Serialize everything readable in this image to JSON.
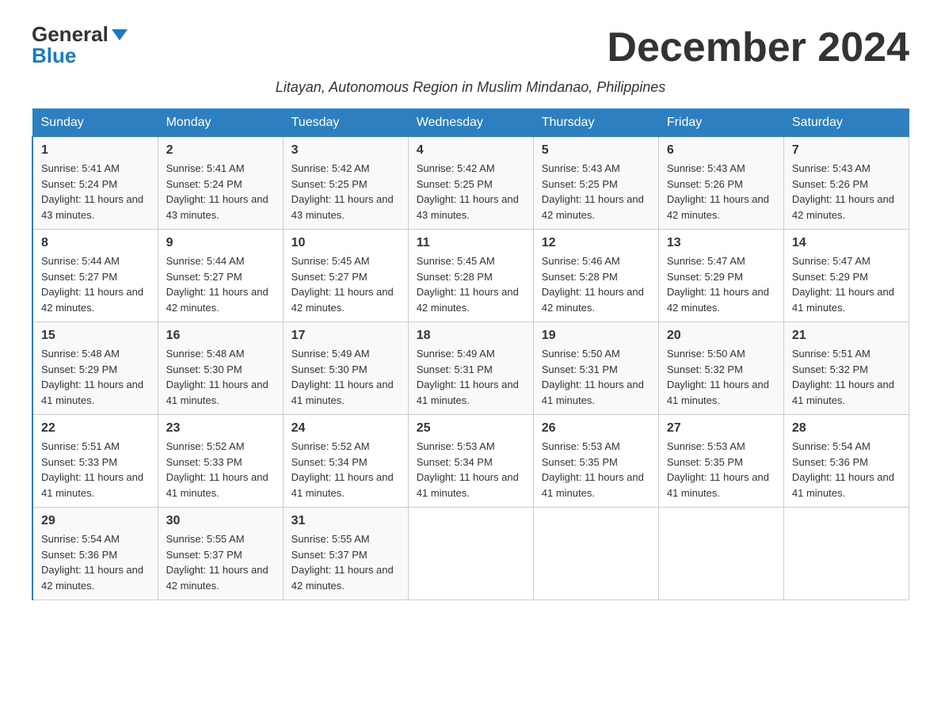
{
  "logo": {
    "general": "General",
    "blue": "Blue"
  },
  "title": "December 2024",
  "subtitle": "Litayan, Autonomous Region in Muslim Mindanao, Philippines",
  "headers": [
    "Sunday",
    "Monday",
    "Tuesday",
    "Wednesday",
    "Thursday",
    "Friday",
    "Saturday"
  ],
  "weeks": [
    [
      {
        "day": "1",
        "sunrise": "5:41 AM",
        "sunset": "5:24 PM",
        "daylight": "11 hours and 43 minutes."
      },
      {
        "day": "2",
        "sunrise": "5:41 AM",
        "sunset": "5:24 PM",
        "daylight": "11 hours and 43 minutes."
      },
      {
        "day": "3",
        "sunrise": "5:42 AM",
        "sunset": "5:25 PM",
        "daylight": "11 hours and 43 minutes."
      },
      {
        "day": "4",
        "sunrise": "5:42 AM",
        "sunset": "5:25 PM",
        "daylight": "11 hours and 43 minutes."
      },
      {
        "day": "5",
        "sunrise": "5:43 AM",
        "sunset": "5:25 PM",
        "daylight": "11 hours and 42 minutes."
      },
      {
        "day": "6",
        "sunrise": "5:43 AM",
        "sunset": "5:26 PM",
        "daylight": "11 hours and 42 minutes."
      },
      {
        "day": "7",
        "sunrise": "5:43 AM",
        "sunset": "5:26 PM",
        "daylight": "11 hours and 42 minutes."
      }
    ],
    [
      {
        "day": "8",
        "sunrise": "5:44 AM",
        "sunset": "5:27 PM",
        "daylight": "11 hours and 42 minutes."
      },
      {
        "day": "9",
        "sunrise": "5:44 AM",
        "sunset": "5:27 PM",
        "daylight": "11 hours and 42 minutes."
      },
      {
        "day": "10",
        "sunrise": "5:45 AM",
        "sunset": "5:27 PM",
        "daylight": "11 hours and 42 minutes."
      },
      {
        "day": "11",
        "sunrise": "5:45 AM",
        "sunset": "5:28 PM",
        "daylight": "11 hours and 42 minutes."
      },
      {
        "day": "12",
        "sunrise": "5:46 AM",
        "sunset": "5:28 PM",
        "daylight": "11 hours and 42 minutes."
      },
      {
        "day": "13",
        "sunrise": "5:47 AM",
        "sunset": "5:29 PM",
        "daylight": "11 hours and 42 minutes."
      },
      {
        "day": "14",
        "sunrise": "5:47 AM",
        "sunset": "5:29 PM",
        "daylight": "11 hours and 41 minutes."
      }
    ],
    [
      {
        "day": "15",
        "sunrise": "5:48 AM",
        "sunset": "5:29 PM",
        "daylight": "11 hours and 41 minutes."
      },
      {
        "day": "16",
        "sunrise": "5:48 AM",
        "sunset": "5:30 PM",
        "daylight": "11 hours and 41 minutes."
      },
      {
        "day": "17",
        "sunrise": "5:49 AM",
        "sunset": "5:30 PM",
        "daylight": "11 hours and 41 minutes."
      },
      {
        "day": "18",
        "sunrise": "5:49 AM",
        "sunset": "5:31 PM",
        "daylight": "11 hours and 41 minutes."
      },
      {
        "day": "19",
        "sunrise": "5:50 AM",
        "sunset": "5:31 PM",
        "daylight": "11 hours and 41 minutes."
      },
      {
        "day": "20",
        "sunrise": "5:50 AM",
        "sunset": "5:32 PM",
        "daylight": "11 hours and 41 minutes."
      },
      {
        "day": "21",
        "sunrise": "5:51 AM",
        "sunset": "5:32 PM",
        "daylight": "11 hours and 41 minutes."
      }
    ],
    [
      {
        "day": "22",
        "sunrise": "5:51 AM",
        "sunset": "5:33 PM",
        "daylight": "11 hours and 41 minutes."
      },
      {
        "day": "23",
        "sunrise": "5:52 AM",
        "sunset": "5:33 PM",
        "daylight": "11 hours and 41 minutes."
      },
      {
        "day": "24",
        "sunrise": "5:52 AM",
        "sunset": "5:34 PM",
        "daylight": "11 hours and 41 minutes."
      },
      {
        "day": "25",
        "sunrise": "5:53 AM",
        "sunset": "5:34 PM",
        "daylight": "11 hours and 41 minutes."
      },
      {
        "day": "26",
        "sunrise": "5:53 AM",
        "sunset": "5:35 PM",
        "daylight": "11 hours and 41 minutes."
      },
      {
        "day": "27",
        "sunrise": "5:53 AM",
        "sunset": "5:35 PM",
        "daylight": "11 hours and 41 minutes."
      },
      {
        "day": "28",
        "sunrise": "5:54 AM",
        "sunset": "5:36 PM",
        "daylight": "11 hours and 41 minutes."
      }
    ],
    [
      {
        "day": "29",
        "sunrise": "5:54 AM",
        "sunset": "5:36 PM",
        "daylight": "11 hours and 42 minutes."
      },
      {
        "day": "30",
        "sunrise": "5:55 AM",
        "sunset": "5:37 PM",
        "daylight": "11 hours and 42 minutes."
      },
      {
        "day": "31",
        "sunrise": "5:55 AM",
        "sunset": "5:37 PM",
        "daylight": "11 hours and 42 minutes."
      },
      null,
      null,
      null,
      null
    ]
  ]
}
